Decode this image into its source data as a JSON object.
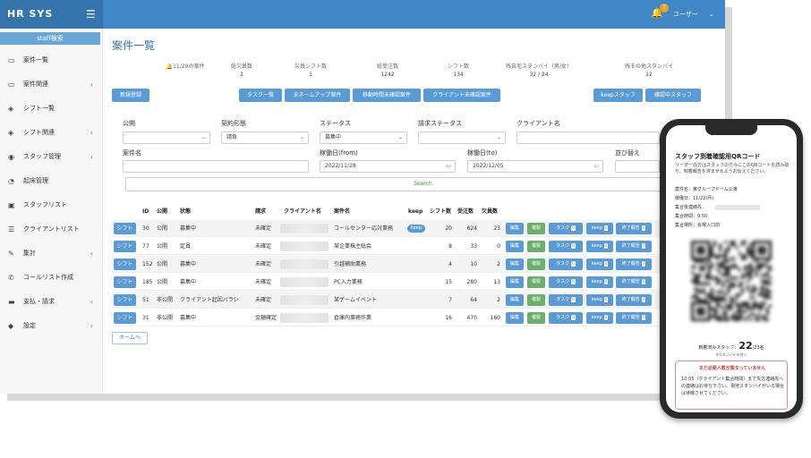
{
  "app": {
    "brand": "HR SYS",
    "user": "ユーザー",
    "notif_count": "7"
  },
  "colors": {
    "primary": "#3f88c5",
    "sidebar_bg": "#f7f7f7",
    "button": "#5b9bd5",
    "green": "#6ab06a",
    "alert": "#d43c3c"
  },
  "sidebar": {
    "search_label": "staff検索",
    "items": [
      {
        "label": "案件一覧",
        "icon": "monitor-icon",
        "chev": false
      },
      {
        "label": "案件関連",
        "icon": "monitor-icon",
        "chev": true
      },
      {
        "label": "シフト一覧",
        "icon": "cube-icon",
        "chev": false
      },
      {
        "label": "シフト関連",
        "icon": "cube-icon",
        "chev": true
      },
      {
        "label": "スタッフ管理",
        "icon": "eye-icon",
        "chev": true
      },
      {
        "label": "起床管理",
        "icon": "dashboard-icon",
        "chev": false
      },
      {
        "label": "スタッフリスト",
        "icon": "id-card-icon",
        "chev": false
      },
      {
        "label": "クライアントリスト",
        "icon": "list-icon",
        "chev": false
      },
      {
        "label": "集計",
        "icon": "edit-icon",
        "chev": true
      },
      {
        "label": "コールリスト作成",
        "icon": "phone-icon",
        "chev": false
      },
      {
        "label": "支払・請求",
        "icon": "money-icon",
        "chev": true
      },
      {
        "label": "設定",
        "icon": "tag-icon",
        "chev": true
      }
    ]
  },
  "main": {
    "title": "案件一覧",
    "stats": [
      {
        "label": "11/29の案件",
        "value": ""
      },
      {
        "label": "総欠員数",
        "value": "2"
      },
      {
        "label": "欠員シフト数",
        "value": "1"
      },
      {
        "label": "総受注数",
        "value": "1242"
      },
      {
        "label": "シフト数",
        "value": "134"
      },
      {
        "label": "残自宅スタンバイ（男/女）",
        "value": "32 / 24"
      },
      {
        "label": "残その他スタンバイ",
        "value": "12"
      }
    ],
    "buttons": {
      "new": "新規登録",
      "task": "タスク一覧",
      "noname": "未ネームアップ案件",
      "travel": "移動時間未確認案件",
      "client": "クライアント未確認案件",
      "keep": "keepスタッフ",
      "confirm": "確認中スタッフ"
    },
    "filters": {
      "public_label": "公開",
      "public_value": "",
      "contract_label": "契約形態",
      "contract_value": "請負",
      "status_label": "ステータス",
      "status_value": "募集中",
      "billing_label": "請求ステータス",
      "billing_value": "",
      "client_label": "クライアント名",
      "client_value": "",
      "case_label": "案件名",
      "case_value": "",
      "from_label": "稼働日(from)",
      "from_value": "2022/11/28",
      "to_label": "稼働日(to)",
      "to_value": "2022/12/05",
      "sort_label": "並び替え",
      "sort_value": "",
      "search_label": "Search"
    },
    "table": {
      "headers": [
        "ID",
        "公開",
        "状態",
        "請求",
        "クライアント名",
        "案件名",
        "keep",
        "シフト数",
        "受注数",
        "欠員数"
      ],
      "shift_label": "シフト",
      "actions": {
        "edit": "編集",
        "copy": "複製",
        "task": "タスク",
        "keep": "keep",
        "end": "終了報告"
      },
      "rows": [
        {
          "id": "30",
          "pub": "公開",
          "state": "募集中",
          "bill": "未確定",
          "name": "コールセンター応対業務",
          "keep": "keep",
          "shifts": "20",
          "orders": "624",
          "vac": "23",
          "tc": "0",
          "kc": "0",
          "ec": "0"
        },
        {
          "id": "77",
          "pub": "公開",
          "state": "定員",
          "bill": "未確定",
          "name": "某企業株主総会",
          "keep": "",
          "shifts": "8",
          "orders": "33",
          "vac": "0",
          "tc": "0",
          "kc": "0",
          "ec": "0"
        },
        {
          "id": "152",
          "pub": "公開",
          "state": "募集中",
          "bill": "未確定",
          "name": "引越補助業務",
          "keep": "",
          "shifts": "4",
          "orders": "10",
          "vac": "2",
          "tc": "0",
          "kc": "0",
          "ec": "0"
        },
        {
          "id": "185",
          "pub": "公開",
          "state": "募集中",
          "bill": "未確定",
          "name": "PC入力業務",
          "keep": "",
          "shifts": "15",
          "orders": "280",
          "vac": "13",
          "tc": "0",
          "kc": "0",
          "ec": "0"
        },
        {
          "id": "51",
          "pub": "非公開",
          "state": "クライアント起因バラシ",
          "bill": "未確定",
          "name": "某ゲームイベント",
          "keep": "",
          "shifts": "7",
          "orders": "64",
          "vac": "2",
          "tc": "0",
          "kc": "0",
          "ec": "0"
        },
        {
          "id": "31",
          "pub": "非公開",
          "state": "募集中",
          "bill": "金額確定",
          "name": "倉庫内事務作業",
          "keep": "",
          "shifts": "16",
          "orders": "470",
          "vac": "160",
          "tc": "0",
          "kc": "0",
          "ec": "0"
        }
      ]
    },
    "home_label": "ホームへ"
  },
  "phone": {
    "title": "スタッフ到着確認用QRコード",
    "desc": "リーダーの方はスタッフの方々にこのQRコードを読み取り、到着報告を済ませるようお伝えください。",
    "case": "案件名：某グループドーム公演",
    "date": "稼働日：11/22(月)",
    "contact": "集合後連絡先：",
    "time": "集合時間：9:50",
    "place": "集合場所：会場入口前",
    "arrived_label": "到着済みスタッフ：",
    "arrived_num": "22",
    "arrived_total": "/23名",
    "arrived_note": "※スタンバイを除く",
    "alert_title": "まだ必要人数が集まっていません",
    "alert_body": "10:05（クライアント集合時間）まで先方連絡先への連絡はお待ち下さい。現地スタンバイがいる場合は待機させてください。"
  }
}
